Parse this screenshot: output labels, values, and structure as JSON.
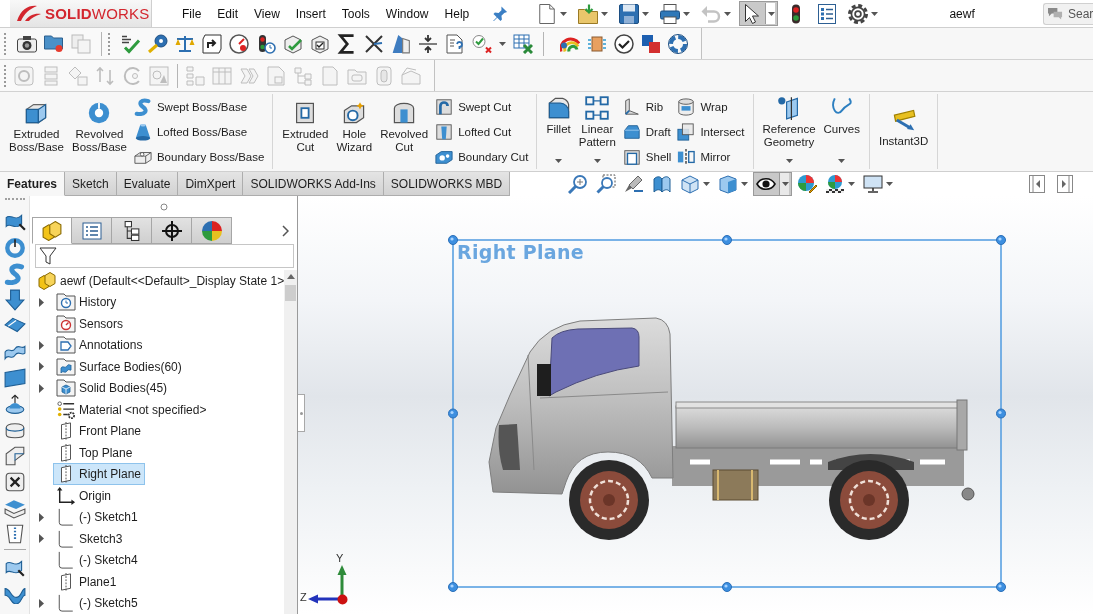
{
  "logo": {
    "wordmark": "**SOLID**WORKS"
  },
  "menu": [
    "File",
    "Edit",
    "View",
    "Insert",
    "Tools",
    "Window",
    "Help"
  ],
  "quick_access": [
    {
      "dropdown": true,
      "selected": false,
      "disabled": false
    },
    {
      "dropdown": true,
      "selected": false,
      "disabled": false
    },
    {
      "dropdown": true,
      "selected": false,
      "disabled": false
    },
    {
      "dropdown": true,
      "selected": false,
      "disabled": false
    },
    {
      "dropdown": true,
      "selected": false,
      "disabled": true
    },
    {
      "dropdown": true,
      "selected": true,
      "disabled": false
    },
    {
      "dropdown": false,
      "selected": false,
      "disabled": false
    },
    {
      "dropdown": false,
      "selected": false,
      "disabled": false
    },
    {
      "dropdown": true,
      "selected": false,
      "disabled": false
    }
  ],
  "document_title": "aewf",
  "search": {
    "placeholder": "Sear"
  },
  "secondary_toolbar": {
    "disabled": true
  },
  "ribbon": {
    "groups": [
      {
        "items": [
          {
            "kind": "large",
            "label": "Extruded Boss/Base",
            "dropdown": false
          },
          {
            "kind": "large",
            "label": "Revolved Boss/Base",
            "dropdown": false
          },
          {
            "kind": "stack",
            "items": [
              {
                "label": "Swept Boss/Base"
              },
              {
                "label": "Lofted Boss/Base"
              },
              {
                "label": "Boundary Boss/Base"
              }
            ]
          }
        ]
      },
      {
        "items": [
          {
            "kind": "large",
            "label": "Extruded Cut",
            "dropdown": false
          },
          {
            "kind": "large",
            "label": "Hole Wizard",
            "dropdown": false
          },
          {
            "kind": "large",
            "label": "Revolved Cut",
            "dropdown": false
          },
          {
            "kind": "stack",
            "items": [
              {
                "label": "Swept Cut"
              },
              {
                "label": "Lofted Cut"
              },
              {
                "label": "Boundary Cut"
              }
            ]
          }
        ]
      },
      {
        "items": [
          {
            "kind": "large",
            "label": "Fillet",
            "dropdown": true
          },
          {
            "kind": "large",
            "label": "Linear Pattern",
            "dropdown": true
          },
          {
            "kind": "stack",
            "items": [
              {
                "label": "Rib"
              },
              {
                "label": "Draft"
              },
              {
                "label": "Shell"
              }
            ]
          },
          {
            "kind": "stack",
            "items": [
              {
                "label": "Wrap"
              },
              {
                "label": "Intersect"
              },
              {
                "label": "Mirror"
              }
            ]
          }
        ]
      },
      {
        "items": [
          {
            "kind": "large",
            "label": "Reference Geometry",
            "dropdown": true
          },
          {
            "kind": "large",
            "label": "Curves",
            "dropdown": true
          }
        ]
      },
      {
        "items": [
          {
            "kind": "large",
            "label": "Instant3D",
            "dropdown": false
          }
        ]
      }
    ]
  },
  "tabs": [
    {
      "label": "Features",
      "selected": true
    },
    {
      "label": "Sketch",
      "selected": false
    },
    {
      "label": "Evaluate",
      "selected": false
    },
    {
      "label": "DimXpert",
      "selected": false
    },
    {
      "label": "SOLIDWORKS Add-Ins",
      "selected": false
    },
    {
      "label": "SOLIDWORKS MBD",
      "selected": false
    }
  ],
  "view_toolbar": [
    {
      "dropdown": false,
      "selected": false
    },
    {
      "dropdown": false,
      "selected": false
    },
    {
      "dropdown": false,
      "selected": false
    },
    {
      "dropdown": false,
      "selected": false
    },
    {
      "dropdown": true,
      "selected": false
    },
    {
      "dropdown": true,
      "selected": false
    },
    {
      "dropdown": true,
      "selected": true
    },
    {
      "dropdown": false,
      "selected": false
    },
    {
      "dropdown": true,
      "selected": false
    },
    {
      "dropdown": true,
      "selected": false
    }
  ],
  "feature_manager": {
    "tabs": [
      {
        "selected": true
      },
      {
        "selected": false
      },
      {
        "selected": false
      },
      {
        "selected": false
      },
      {
        "selected": false
      }
    ],
    "tree": {
      "kind": "part",
      "label": "aewf (Default<<Default>_Display State 1>",
      "selected": false,
      "children": [
        {
          "kind": "history",
          "label": "History",
          "expanded": false,
          "selected": false
        },
        {
          "kind": "sensors",
          "label": "Sensors",
          "selected": false
        },
        {
          "kind": "annotations",
          "label": "Annotations",
          "expanded": false,
          "selected": false
        },
        {
          "kind": "surface-bodies",
          "label": "Surface Bodies(60)",
          "expanded": false,
          "selected": false
        },
        {
          "kind": "solid-bodies",
          "label": "Solid Bodies(45)",
          "expanded": false,
          "selected": false
        },
        {
          "kind": "material",
          "label": "Material <not specified>",
          "selected": false
        },
        {
          "kind": "plane",
          "label": "Front Plane",
          "selected": false
        },
        {
          "kind": "plane",
          "label": "Top Plane",
          "selected": false
        },
        {
          "kind": "plane",
          "label": "Right Plane",
          "selected": true
        },
        {
          "kind": "origin",
          "label": "Origin",
          "selected": false
        },
        {
          "kind": "sketch",
          "label": "(-) Sketch1",
          "expanded": false,
          "selected": false
        },
        {
          "kind": "sketch",
          "label": "Sketch3",
          "expanded": false,
          "selected": false
        },
        {
          "kind": "sketch",
          "label": "(-) Sketch4",
          "selected": false
        },
        {
          "kind": "plane",
          "label": "Plane1",
          "selected": false
        },
        {
          "kind": "sketch",
          "label": "(-) Sketch5",
          "expanded": false,
          "selected": false
        }
      ]
    }
  },
  "viewport": {
    "plane_label": "Right Plane",
    "triad": {
      "y_label": "Y",
      "z_label": "Z"
    }
  }
}
